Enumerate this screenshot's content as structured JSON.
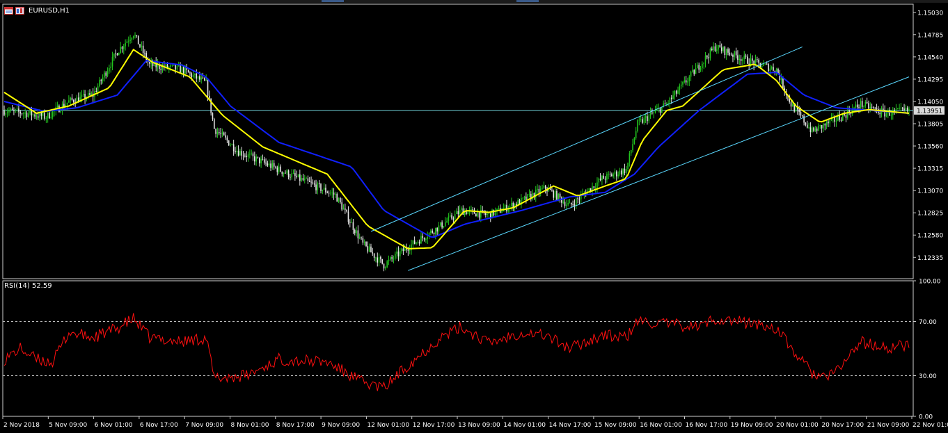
{
  "window": {
    "symbol_title": "EURUSD,H1"
  },
  "rsi": {
    "label": "RSI(14) 52.59",
    "levels": [
      70,
      30
    ]
  },
  "colors": {
    "background": "#000000",
    "bull_candle": "#22c41e",
    "bear_candle": "#e6e6e6",
    "ma_fast": "#ffff00",
    "ma_slow": "#1020ff",
    "channel": "#5ad8ff",
    "rsi_line": "#ff1010",
    "grid_text": "#ffffff",
    "current_price_line": "#6fd0d8"
  },
  "chart_data": [
    {
      "type": "candlestick",
      "title": "EURUSD,H1",
      "y_ticks": [
        "1.15030",
        "1.14785",
        "1.14540",
        "1.14295",
        "1.14050",
        "1.13805",
        "1.13560",
        "1.13315",
        "1.13070",
        "1.12825",
        "1.12580",
        "1.12335"
      ],
      "ylim": [
        1.121,
        1.1512
      ],
      "current_price": "1.13951",
      "x_ticks": [
        "2 Nov 2018",
        "5 Nov 09:00",
        "6 Nov 01:00",
        "6 Nov 17:00",
        "7 Nov 09:00",
        "8 Nov 01:00",
        "8 Nov 17:00",
        "9 Nov 09:00",
        "12 Nov 01:00",
        "12 Nov 17:00",
        "13 Nov 09:00",
        "14 Nov 01:00",
        "14 Nov 17:00",
        "15 Nov 09:00",
        "16 Nov 01:00",
        "16 Nov 17:00",
        "19 Nov 09:00",
        "20 Nov 01:00",
        "20 Nov 17:00",
        "21 Nov 09:00",
        "22 Nov 01:00"
      ],
      "close_keypoints": [
        [
          0,
          1.1395
        ],
        [
          14,
          1.1392
        ],
        [
          26,
          1.1388
        ],
        [
          40,
          1.1405
        ],
        [
          55,
          1.1412
        ],
        [
          70,
          1.146
        ],
        [
          80,
          1.148
        ],
        [
          90,
          1.1445
        ],
        [
          110,
          1.144
        ],
        [
          125,
          1.1425
        ],
        [
          130,
          1.1375
        ],
        [
          145,
          1.135
        ],
        [
          170,
          1.133
        ],
        [
          205,
          1.1302
        ],
        [
          222,
          1.1248
        ],
        [
          235,
          1.1225
        ],
        [
          250,
          1.1245
        ],
        [
          270,
          1.1268
        ],
        [
          283,
          1.1285
        ],
        [
          300,
          1.128
        ],
        [
          320,
          1.1295
        ],
        [
          335,
          1.131
        ],
        [
          350,
          1.129
        ],
        [
          370,
          1.132
        ],
        [
          385,
          1.133
        ],
        [
          392,
          1.138
        ],
        [
          410,
          1.1402
        ],
        [
          440,
          1.1465
        ],
        [
          460,
          1.145
        ],
        [
          478,
          1.144
        ],
        [
          487,
          1.1402
        ],
        [
          500,
          1.1372
        ],
        [
          520,
          1.139
        ],
        [
          530,
          1.1402
        ],
        [
          545,
          1.1392
        ],
        [
          560,
          1.1395
        ]
      ],
      "ma_fast_keypoints": [
        [
          0,
          1.1415
        ],
        [
          20,
          1.1392
        ],
        [
          40,
          1.14
        ],
        [
          65,
          1.142
        ],
        [
          80,
          1.1462
        ],
        [
          92,
          1.1448
        ],
        [
          115,
          1.1432
        ],
        [
          135,
          1.139
        ],
        [
          160,
          1.1355
        ],
        [
          200,
          1.1325
        ],
        [
          225,
          1.1268
        ],
        [
          250,
          1.1243
        ],
        [
          265,
          1.1244
        ],
        [
          285,
          1.1285
        ],
        [
          300,
          1.1283
        ],
        [
          315,
          1.1288
        ],
        [
          340,
          1.1312
        ],
        [
          355,
          1.1301
        ],
        [
          372,
          1.1312
        ],
        [
          385,
          1.132
        ],
        [
          395,
          1.1362
        ],
        [
          410,
          1.1395
        ],
        [
          420,
          1.14
        ],
        [
          445,
          1.144
        ],
        [
          465,
          1.1446
        ],
        [
          478,
          1.1428
        ],
        [
          490,
          1.14
        ],
        [
          505,
          1.1382
        ],
        [
          520,
          1.1392
        ],
        [
          535,
          1.1396
        ],
        [
          560,
          1.1392
        ]
      ],
      "ma_slow_keypoints": [
        [
          0,
          1.1405
        ],
        [
          25,
          1.1394
        ],
        [
          45,
          1.1398
        ],
        [
          70,
          1.1412
        ],
        [
          88,
          1.145
        ],
        [
          110,
          1.1445
        ],
        [
          125,
          1.1432
        ],
        [
          140,
          1.14
        ],
        [
          170,
          1.136
        ],
        [
          215,
          1.1333
        ],
        [
          235,
          1.1285
        ],
        [
          265,
          1.1255
        ],
        [
          285,
          1.127
        ],
        [
          320,
          1.1285
        ],
        [
          350,
          1.13
        ],
        [
          372,
          1.1305
        ],
        [
          390,
          1.1325
        ],
        [
          405,
          1.1355
        ],
        [
          430,
          1.1395
        ],
        [
          460,
          1.1435
        ],
        [
          478,
          1.1437
        ],
        [
          495,
          1.1412
        ],
        [
          515,
          1.1398
        ],
        [
          560,
          1.1392
        ]
      ],
      "channel_lines": [
        {
          "from": [
            227,
            1.1262
          ],
          "to": [
            494,
            1.1465
          ]
        },
        {
          "from": [
            250,
            1.1219
          ],
          "to": [
            560,
            1.1432
          ]
        }
      ]
    },
    {
      "type": "line",
      "title": "RSI(14) 52.59",
      "y_ticks": [
        "100.00",
        "70.00",
        "30.00",
        "0.00"
      ],
      "ylim": [
        0,
        100
      ],
      "levels": [
        70,
        30
      ],
      "series_keypoints": [
        [
          0,
          42
        ],
        [
          10,
          50
        ],
        [
          20,
          42
        ],
        [
          30,
          40
        ],
        [
          40,
          62
        ],
        [
          55,
          58
        ],
        [
          70,
          65
        ],
        [
          80,
          72
        ],
        [
          90,
          58
        ],
        [
          110,
          55
        ],
        [
          125,
          58
        ],
        [
          130,
          28
        ],
        [
          150,
          30
        ],
        [
          170,
          42
        ],
        [
          200,
          40
        ],
        [
          222,
          25
        ],
        [
          235,
          21
        ],
        [
          250,
          38
        ],
        [
          270,
          58
        ],
        [
          283,
          66
        ],
        [
          300,
          54
        ],
        [
          320,
          62
        ],
        [
          335,
          60
        ],
        [
          350,
          50
        ],
        [
          370,
          60
        ],
        [
          385,
          58
        ],
        [
          392,
          70
        ],
        [
          410,
          68
        ],
        [
          430,
          66
        ],
        [
          440,
          72
        ],
        [
          460,
          69
        ],
        [
          478,
          65
        ],
        [
          487,
          50
        ],
        [
          500,
          32
        ],
        [
          510,
          28
        ],
        [
          520,
          40
        ],
        [
          530,
          55
        ],
        [
          545,
          50
        ],
        [
          560,
          53
        ]
      ]
    }
  ]
}
